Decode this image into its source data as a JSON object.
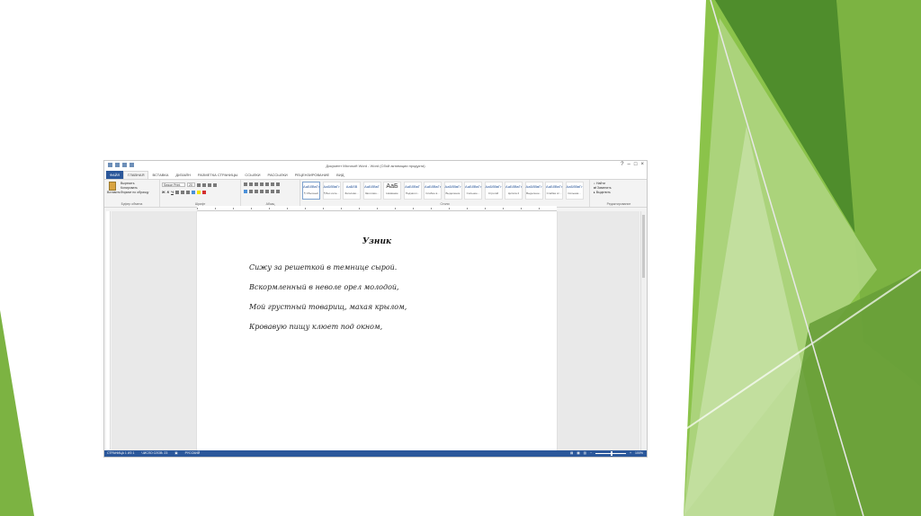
{
  "colors": {
    "word_blue": "#2b579a",
    "green_dark": "#4f8d2c",
    "green_mid": "#7cb342",
    "green_light": "#c5e1a5"
  },
  "window": {
    "title": "Документ Microsoft Word - Word (Сбой активации продукта)"
  },
  "tabs": [
    "ФАЙЛ",
    "ГЛАВНАЯ",
    "ВСТАВКА",
    "ДИЗАЙН",
    "РАЗМЕТКА СТРАНИЦЫ",
    "ССЫЛКИ",
    "РАССЫЛКИ",
    "РЕЦЕНЗИРОВАНИЕ",
    "ВИД"
  ],
  "ribbon": {
    "clipboard": {
      "paste": "Вставить",
      "cut": "Вырезать",
      "copy": "Копировать",
      "format_painter": "Формат по образцу",
      "label": "Буфер обмена"
    },
    "font": {
      "name": "Segoe Print",
      "size": "20",
      "label": "Шрифт"
    },
    "paragraph": {
      "label": "Абзац"
    },
    "styles": {
      "label": "Стили",
      "items": [
        {
          "preview": "АаБбВвГг",
          "name": "¶ Обычный"
        },
        {
          "preview": "АаБбВвГг",
          "name": "¶ Без инте..."
        },
        {
          "preview": "АаБбВ",
          "name": "Заголово..."
        },
        {
          "preview": "АаБбВвГ",
          "name": "Заголово..."
        },
        {
          "preview": "АаБ",
          "name": "Название"
        },
        {
          "preview": "АаБбВвГ",
          "name": "Подзагол..."
        },
        {
          "preview": "АаБбВвГг",
          "name": "Слабое в..."
        },
        {
          "preview": "АаБбВвГг",
          "name": "Выделение"
        },
        {
          "preview": "АаБбВвГг",
          "name": "Сильное..."
        },
        {
          "preview": "АаБбВвГг",
          "name": "Строгий"
        },
        {
          "preview": "АаБбВвГг",
          "name": "Цитата 2"
        },
        {
          "preview": "АаБбВвГг",
          "name": "Выделенн..."
        },
        {
          "preview": "АаБбВвГг",
          "name": "Слабая сс..."
        },
        {
          "preview": "АаБбВвГг",
          "name": "Сильная..."
        }
      ]
    },
    "editing": {
      "find": "Найти",
      "replace": "Заменить",
      "select": "Выделить",
      "label": "Редактирование"
    }
  },
  "document": {
    "title": "Узник",
    "lines": [
      "Сижу за решеткой в темнице сырой.",
      "Вскормленный в неволе орел молодой,",
      "Мой грустный товарищ, махая крылом,",
      "Кровавую пищу клюет под окном,"
    ]
  },
  "statusbar": {
    "page": "СТРАНИЦА 1 ИЗ 1",
    "words": "ЧИСЛО СЛОВ: 23",
    "language": "РУССКИЙ",
    "zoom": "100%"
  }
}
